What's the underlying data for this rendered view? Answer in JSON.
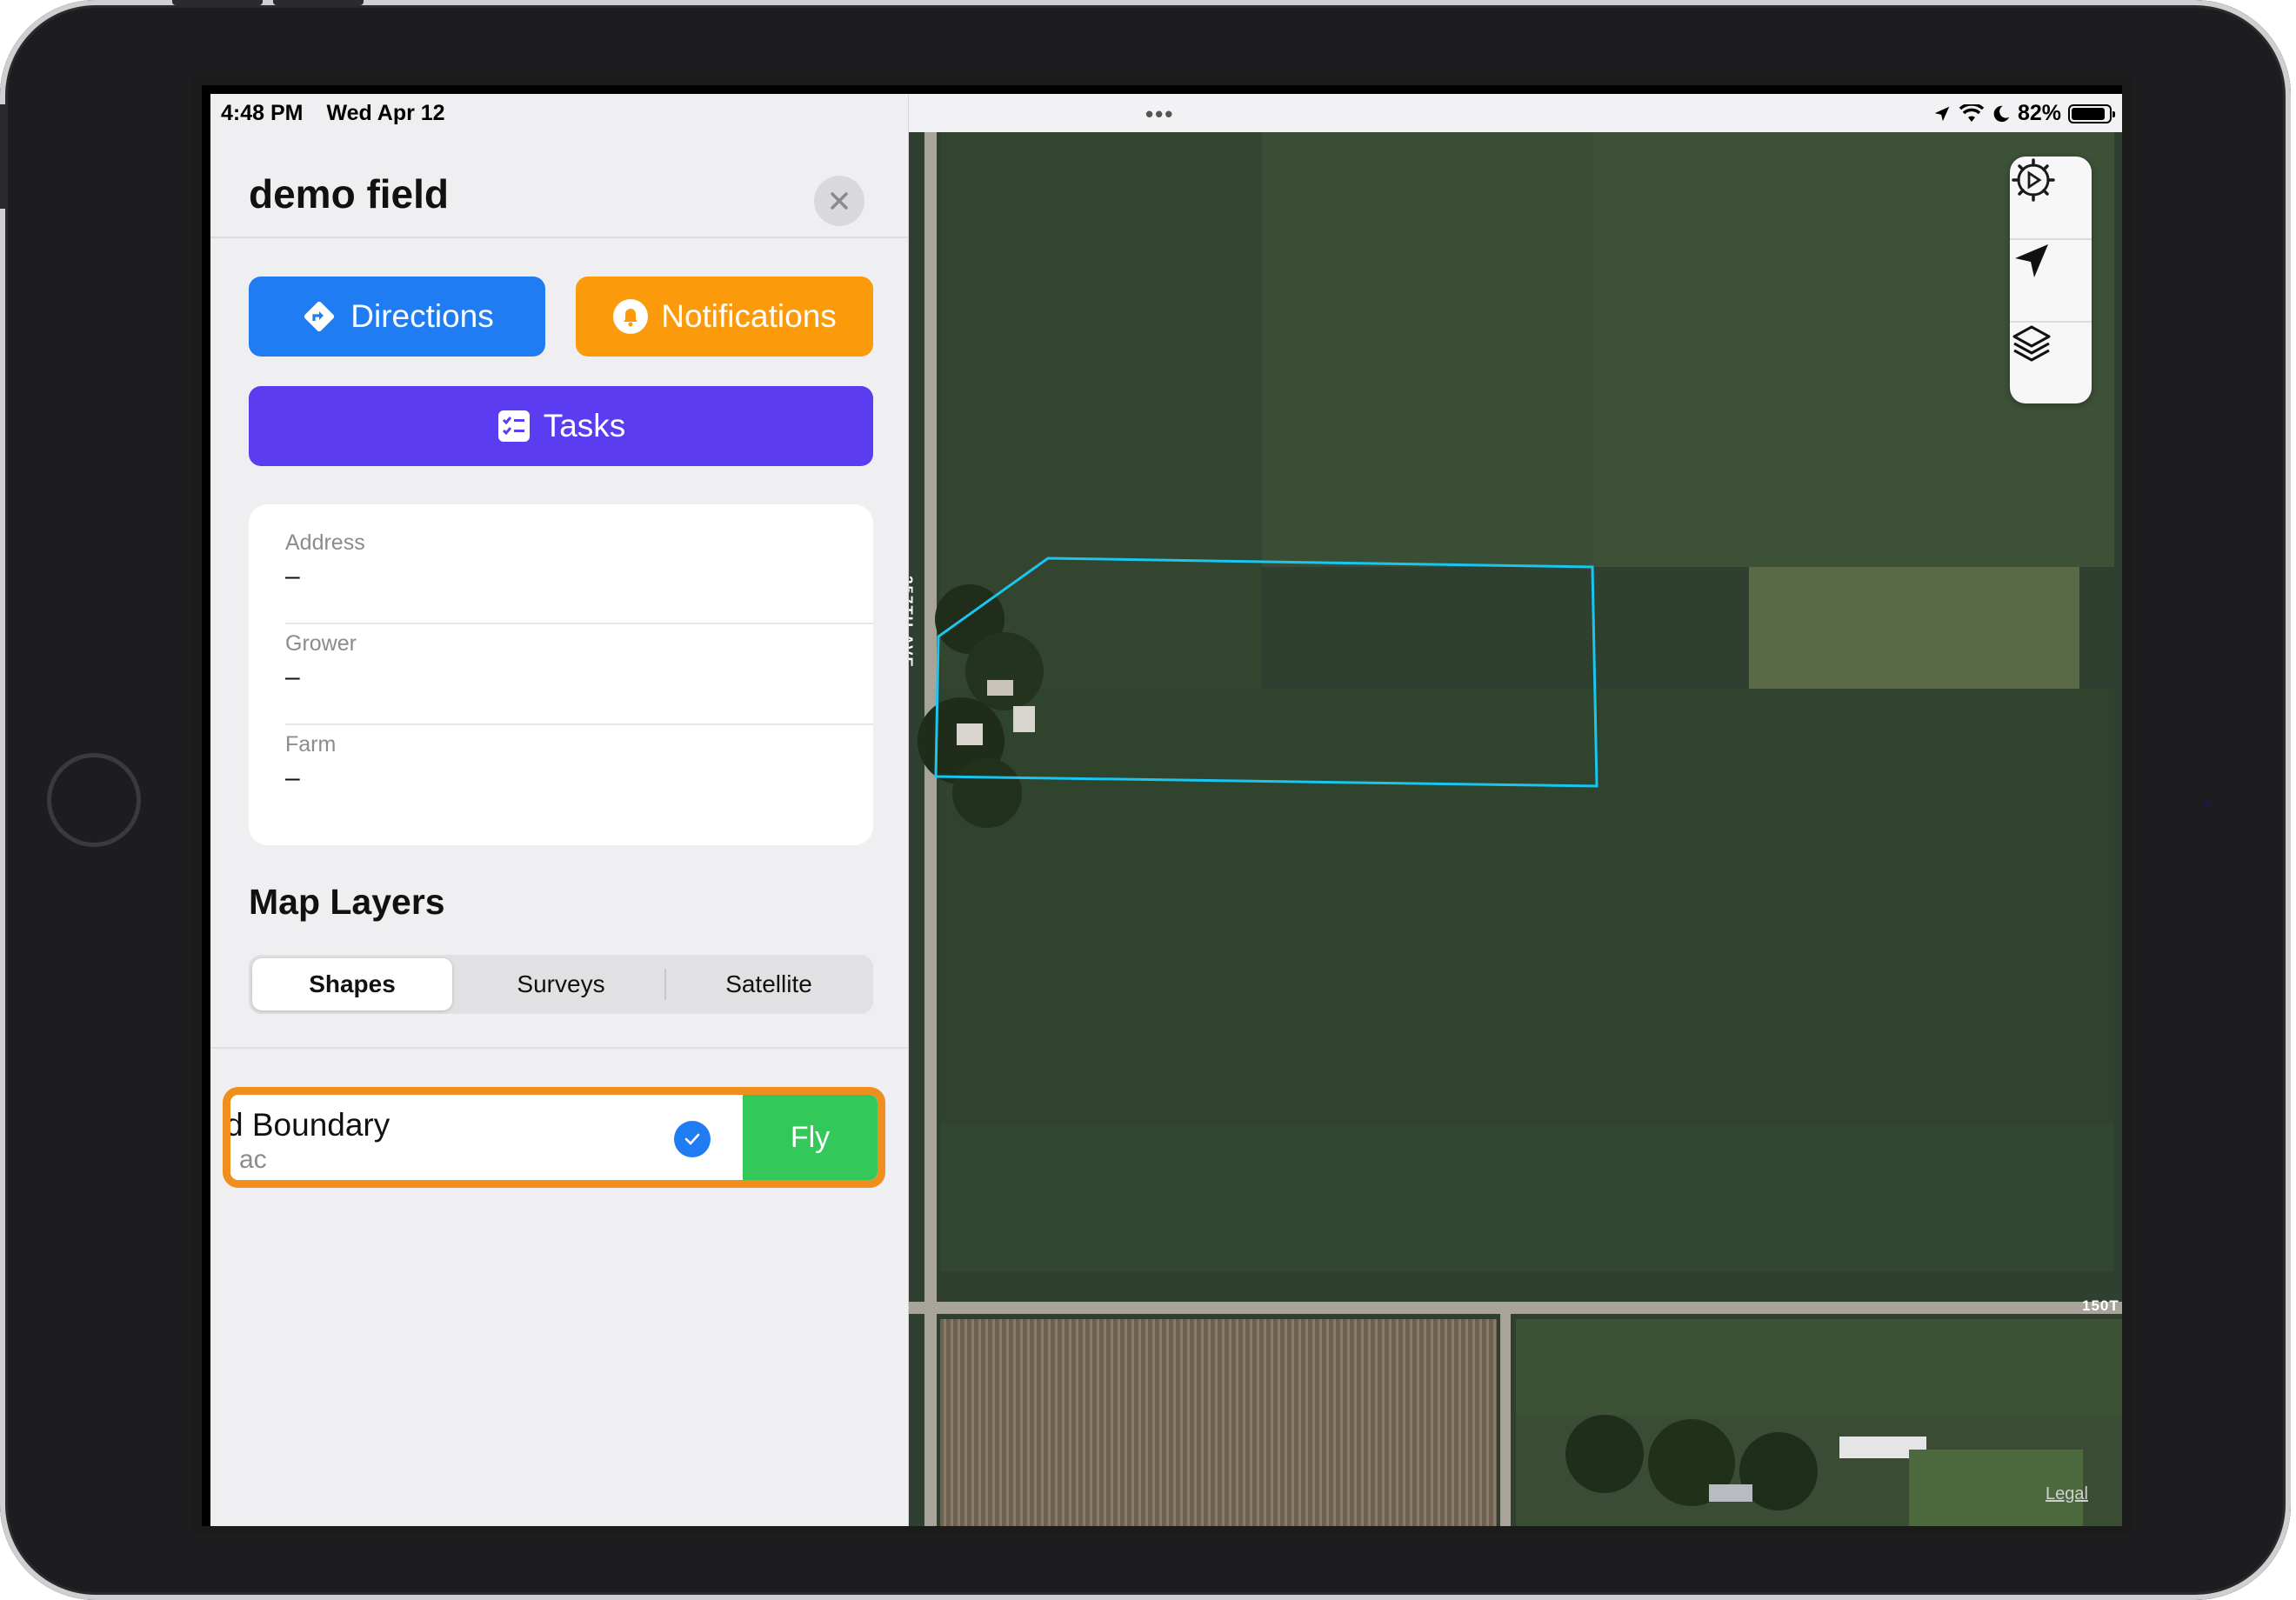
{
  "status_bar": {
    "time": "4:48 PM",
    "date": "Wed Apr 12",
    "battery": "82%",
    "battery_level": 0.82,
    "multitask_dots": "•••"
  },
  "panel": {
    "title": "demo field",
    "buttons": {
      "directions": "Directions",
      "notifications": "Notifications",
      "tasks": "Tasks"
    },
    "info": [
      {
        "label": "Address",
        "value": "–"
      },
      {
        "label": "Grower",
        "value": "–"
      },
      {
        "label": "Farm",
        "value": "–"
      }
    ],
    "map_layers_title": "Map Layers",
    "segments": [
      "Shapes",
      "Surveys",
      "Satellite"
    ],
    "selected_segment": "Shapes",
    "layer_row": {
      "name": "d Boundary",
      "subtitle": "ac",
      "checked": true,
      "action": "Fly"
    }
  },
  "map": {
    "road_vertical": "257TH AVE",
    "road_horizontal": "150T",
    "legal": "Legal",
    "controls": [
      "settings-icon",
      "location-arrow-icon",
      "layers-icon"
    ],
    "boundary_color": "#19c6f0"
  },
  "colors": {
    "directions": "#1f7cf2",
    "notifications": "#fb9b0c",
    "tasks": "#5b3cf1",
    "fly": "#34c759",
    "highlight": "#f08f1e"
  }
}
